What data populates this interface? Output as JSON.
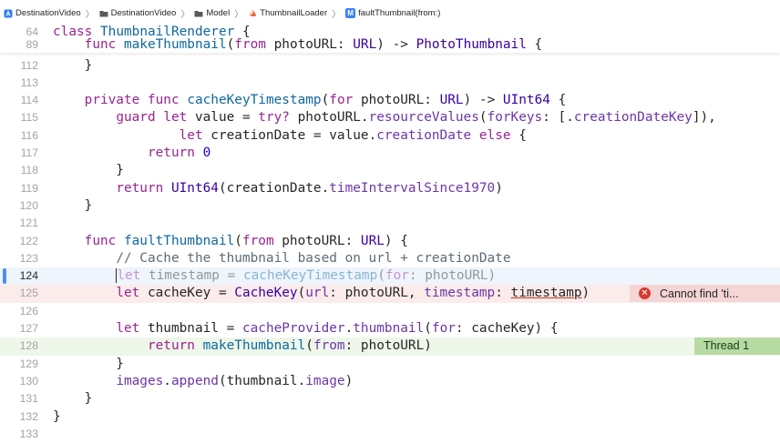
{
  "jumpbar": {
    "items": [
      "DestinationVideo",
      "DestinationVideo",
      "Model",
      "ThumbnailLoader",
      "faultThumbnail(from:)"
    ]
  },
  "sticky": [
    {
      "num": "64",
      "code": "class ThumbnailRenderer {"
    },
    {
      "num": "89",
      "code": "    func makeThumbnail(from photoURL: URL) -> PhotoThumbnail {"
    }
  ],
  "lines": [
    {
      "num": "112",
      "code": "    }"
    },
    {
      "num": "113",
      "code": ""
    },
    {
      "num": "114",
      "code": "    private func cacheKeyTimestamp(for photoURL: URL) -> UInt64 {"
    },
    {
      "num": "115",
      "code": "        guard let value = try? photoURL.resourceValues(forKeys: [.creationDateKey]),"
    },
    {
      "num": "116",
      "code": "                let creationDate = value.creationDate else {"
    },
    {
      "num": "117",
      "code": "            return 0"
    },
    {
      "num": "118",
      "code": "        }"
    },
    {
      "num": "119",
      "code": "        return UInt64(creationDate.timeIntervalSince1970)"
    },
    {
      "num": "120",
      "code": "    }"
    },
    {
      "num": "121",
      "code": ""
    },
    {
      "num": "122",
      "code": "    func faultThumbnail(from photoURL: URL) {"
    },
    {
      "num": "123",
      "code": "        // Cache the thumbnail based on url + creationDate"
    },
    {
      "num": "124",
      "code": "        let timestamp = cacheKeyTimestamp(for: photoURL)"
    },
    {
      "num": "125",
      "code": "        let cacheKey = CacheKey(url: photoURL, timestamp: timestamp)"
    },
    {
      "num": "126",
      "code": ""
    },
    {
      "num": "127",
      "code": "        let thumbnail = cacheProvider.thumbnail(for: cacheKey) {"
    },
    {
      "num": "128",
      "code": "            return makeThumbnail(from: photoURL)"
    },
    {
      "num": "129",
      "code": "        }"
    },
    {
      "num": "130",
      "code": "        images.append(thumbnail.image)"
    },
    {
      "num": "131",
      "code": "    }"
    },
    {
      "num": "132",
      "code": "}"
    },
    {
      "num": "133",
      "code": ""
    }
  ],
  "error": {
    "text": "Cannot find 'ti...",
    "icon": "error-x-icon",
    "color": "#d6392e"
  },
  "thread": {
    "text": "Thread 1",
    "color": "#b7dba3"
  },
  "colors": {
    "keyword": "#9b2393",
    "type": "#3900a0",
    "decl": "#0f68a0",
    "member": "#6c36a9",
    "number": "#1c00cf",
    "comment": "#5d6c79"
  }
}
